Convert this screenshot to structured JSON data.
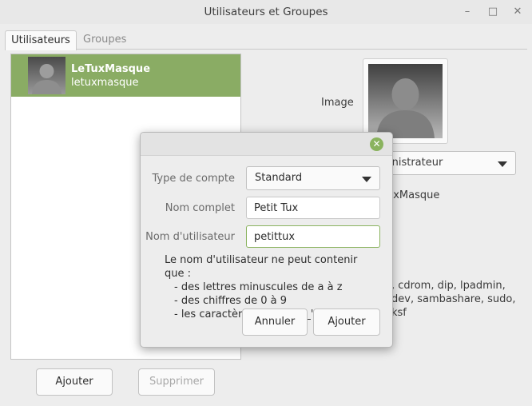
{
  "window": {
    "title": "Utilisateurs et Groupes",
    "minimize_glyph": "–",
    "maximize_glyph": "□",
    "close_glyph": "✕"
  },
  "tabs": [
    {
      "label": "Utilisateurs",
      "active": true
    },
    {
      "label": "Groupes",
      "active": false
    }
  ],
  "users": [
    {
      "name": "LeTuxMasque",
      "login": "letuxmasque"
    }
  ],
  "buttons": {
    "add": "Ajouter",
    "remove": "Supprimer"
  },
  "details": {
    "image_label": "Image",
    "account_type_value": "inistrateur",
    "fullname_value": "uxMasque",
    "password_value": "·",
    "groups_value": ", cdrom, dip, lpadmin,\ndev, sambashare, sudo,\nksf"
  },
  "dialog": {
    "close_glyph": "✕",
    "type_label": "Type de compte",
    "type_value": "Standard",
    "fullname_label": "Nom complet",
    "fullname_value": "Petit Tux",
    "username_label": "Nom d'utilisateur",
    "username_value": "petittux",
    "hint_intro": "Le nom d'utilisateur ne peut contenir que :",
    "hint_items": [
      "- des lettres minuscules de a à z",
      "- des chiffres de 0 à 9",
      "- les caractères '.', '-', et '_'"
    ],
    "cancel": "Annuler",
    "ok": "Ajouter"
  },
  "colors": {
    "accent": "#8aac64",
    "close_button": "#8ab35e"
  }
}
